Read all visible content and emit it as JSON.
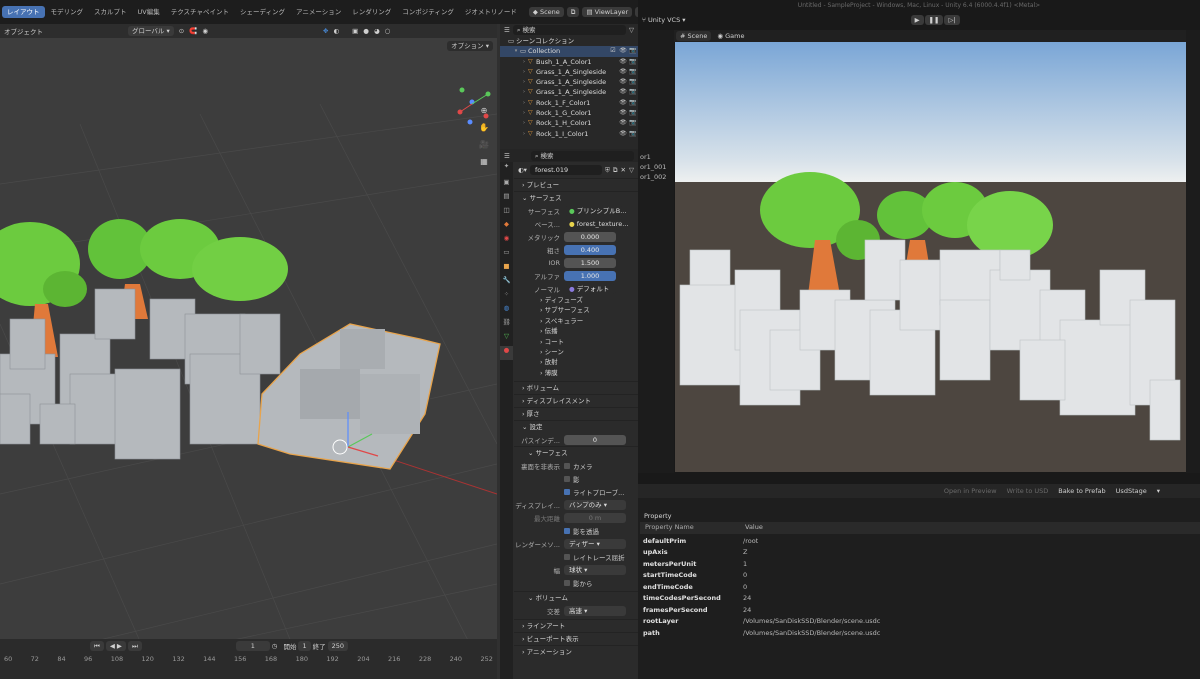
{
  "blender": {
    "workspaces": [
      "レイアウト",
      "モデリング",
      "スカルプト",
      "UV編集",
      "テクスチャペイント",
      "シェーディング",
      "アニメーション",
      "レンダリング",
      "コンポジティング",
      "ジオメトリノード"
    ],
    "scene_name": "Scene",
    "view_layer": "ViewLayer",
    "viewport": {
      "mode": "オブジェクト",
      "transform": "グローバル",
      "options": "オプション"
    },
    "outliner": {
      "search_placeholder": "検索",
      "root": "シーンコレクション",
      "collection": "Collection",
      "items": [
        "Bush_1_A_Color1",
        "Grass_1_A_Singleside",
        "Grass_1_A_Singleside",
        "Grass_1_A_Singleside",
        "Rock_1_F_Color1",
        "Rock_1_G_Color1",
        "Rock_1_H_Color1",
        "Rock_1_I_Color1"
      ]
    },
    "properties": {
      "search_placeholder": "検索",
      "material": "forest.019",
      "preview": "プレビュー",
      "surface": "サーフェス",
      "surface_label": "サーフェス",
      "surface_value": "プリンシプルB...",
      "base_label": "ベース...",
      "base_value": "forest_texture...",
      "metallic_label": "メタリック",
      "metallic_value": "0.000",
      "roughness_label": "粗さ",
      "roughness_value": "0.400",
      "ior_label": "IOR",
      "ior_value": "1.500",
      "alpha_label": "アルファ",
      "alpha_value": "1.000",
      "normal_label": "ノーマル",
      "normal_value": "デフォルト",
      "subpanels": [
        "ディフューズ",
        "サブサーフェス",
        "スペキュラー",
        "伝播",
        "コート",
        "シーン",
        "放射",
        "薄膜"
      ],
      "volume": "ボリューム",
      "displacement": "ディスプレイスメント",
      "thickness": "厚さ",
      "settings": "設定",
      "pass_label": "パスインデ...",
      "pass_value": "0",
      "settings_surface": "サーフェス",
      "backface_label": "裏面を非表示",
      "camera": "カメラ",
      "shadow": "影",
      "light_probe": "ライトプローブ...",
      "display_label": "ディスプレイ...",
      "display_value": "バンプのみ",
      "max_disp_label": "最大距離",
      "max_disp_value": "0 m",
      "transparent_shadow": "影を透過",
      "render_method_label": "レンダーメソ...",
      "render_method_value": "ディザー",
      "raytrace_refraction": "レイトレース屈折",
      "thickness_label": "幅",
      "thickness_value": "球状",
      "from_shadow": "影から",
      "volume2": "ボリューム",
      "intersection_label": "交差",
      "intersection_value": "高速",
      "lineart": "ラインアート",
      "viewport_display": "ビューポート表示",
      "animation": "アニメーション"
    },
    "timeline": {
      "frame": "1",
      "start_label": "開始",
      "start": "1",
      "end_label": "終了",
      "end": "250",
      "ticks": [
        "60",
        "72",
        "84",
        "96",
        "108",
        "120",
        "132",
        "144",
        "156",
        "168",
        "180",
        "192",
        "204",
        "216",
        "228",
        "240",
        "252"
      ]
    }
  },
  "unity": {
    "title": "Untitled - SampleProject - Windows, Mac, Linux - Unity 6.4 (6000.4.4f1) <Metal>",
    "vcs": "Unity VCS",
    "tabs": [
      "Scene",
      "Game"
    ],
    "hierarchy_fragments": [
      "or1",
      "or1_001",
      "or1_002"
    ],
    "usd_buttons": [
      "Open in Preview",
      "Write to USD",
      "Bake to Prefab",
      "UsdStage"
    ],
    "property_header": "Property",
    "col_name": "Property Name",
    "col_value": "Value",
    "rows": [
      {
        "name": "defaultPrim",
        "value": "/root"
      },
      {
        "name": "upAxis",
        "value": "Z"
      },
      {
        "name": "metersPerUnit",
        "value": "1"
      },
      {
        "name": "startTimeCode",
        "value": "0"
      },
      {
        "name": "endTimeCode",
        "value": "0"
      },
      {
        "name": "timeCodesPerSecond",
        "value": "24"
      },
      {
        "name": "framesPerSecond",
        "value": "24"
      },
      {
        "name": "rootLayer",
        "value": "/Volumes/SanDiskSSD/Blender/scene.usdc"
      },
      {
        "name": "path",
        "value": "/Volumes/SanDiskSSD/Blender/scene.usdc"
      }
    ]
  },
  "colors": {
    "blender_bg": "#303030",
    "viewport": "#3d3d3d",
    "accent": "#4772b3",
    "selection": "#e8a44c",
    "tree_green": "#6ccb3f",
    "trunk": "#e0793a",
    "rock": "#bfc3c7",
    "sky_top": "#7aa6d6",
    "ground": "#4d4640"
  }
}
